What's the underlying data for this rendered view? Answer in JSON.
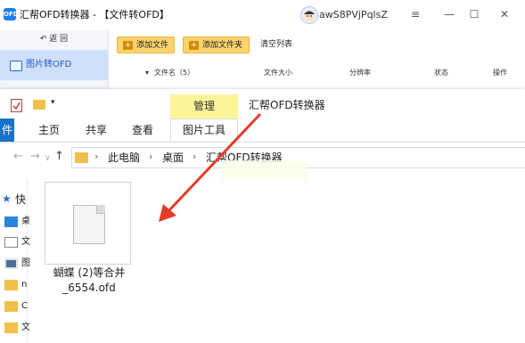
{
  "app": {
    "logo_text": "OFD",
    "title": "汇帮OFD转换器 - 【文件转OFD】",
    "username": "awS8PVjPqlsZ",
    "window_controls": [
      "≡",
      "—",
      "☐",
      "✕"
    ],
    "back_label": "返 回",
    "back_icon": "↶",
    "sidebar_active": "图片转OFD",
    "toolbar": {
      "add_file": "添加文件",
      "add_folder": "添加文件夹",
      "clear_list": "清空列表"
    },
    "columns": [
      "文件名（5）",
      "文件大小",
      "分辨率",
      "状态",
      "操作"
    ],
    "sort_glyph": "▾"
  },
  "explorer": {
    "qa_down": "▾",
    "ribbon_context_group": "管理",
    "window_title": "汇帮OFD转换器",
    "tabs": {
      "file": "件",
      "home": "主页",
      "share": "共享",
      "view": "查看",
      "picture_tools": "图片工具"
    },
    "nav": {
      "back": "←",
      "forward": "→",
      "dropdown": "∨",
      "up": "↑"
    },
    "breadcrumbs": [
      "此电脑",
      "桌面",
      "汇帮OFD转换器"
    ],
    "sep": "›",
    "nav_pane": {
      "quick_access_icon": "★",
      "quick_access_label": "快",
      "items": [
        "桌",
        "文",
        "图",
        "n",
        "C",
        "文"
      ]
    },
    "file": {
      "name": "蝴蝶 (2)等合并\n_6554.ofd"
    }
  },
  "colors": {
    "accent": "#1a73c9",
    "arrow": "#e53c2a",
    "context_tab": "#fdf49a",
    "toolbar_button": "#fbd36d"
  }
}
